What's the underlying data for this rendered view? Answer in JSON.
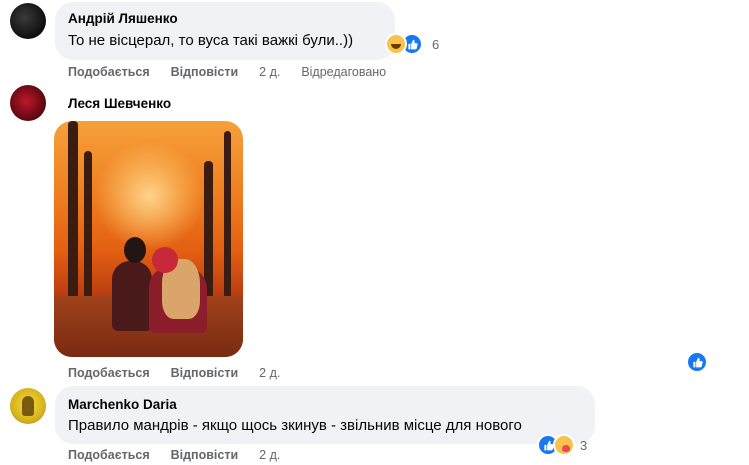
{
  "comments": [
    {
      "author": "Андрій Ляшенко",
      "text": "То не вісцерал, то вуса такі важкі були..))",
      "reaction_count": "6",
      "reactions": [
        "haha-icon",
        "like-icon"
      ],
      "like_label": "Подобається",
      "reply_label": "Відповісти",
      "time": "2 д.",
      "edited_label": "Відредаговано"
    },
    {
      "author": "Леся Шевченко",
      "has_photo": true,
      "like_label": "Подобається",
      "reply_label": "Відповісти",
      "time": "2 д."
    },
    {
      "author": "Marchenko Daria",
      "text": "Правило мандрів - якщо щось зкинув - звільнив місце для нового",
      "reaction_count": "3",
      "reactions": [
        "like-icon",
        "care-icon"
      ],
      "like_label": "Подобається",
      "reply_label": "Відповісти",
      "time": "2 д."
    }
  ],
  "colors": {
    "bubble_bg": "#f0f2f5",
    "meta_text": "#65676b",
    "like_blue": "#1877f2"
  }
}
